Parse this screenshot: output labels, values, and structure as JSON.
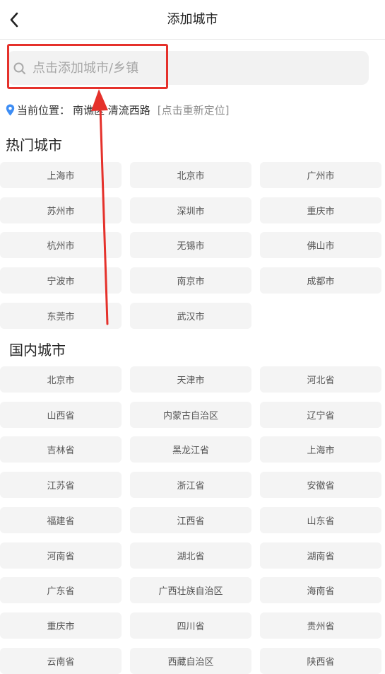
{
  "header": {
    "title": "添加城市",
    "back_icon": "chevron-left-icon"
  },
  "search": {
    "placeholder": "点击添加城市/乡镇",
    "icon": "search-icon"
  },
  "location": {
    "icon": "map-pin-icon",
    "label": "当前位置：",
    "value": "南谯区 清流西路",
    "relocate_label": "[点击重新定位]"
  },
  "hot": {
    "title": "热门城市",
    "cities": [
      "上海市",
      "北京市",
      "广州市",
      "苏州市",
      "深圳市",
      "重庆市",
      "杭州市",
      "无锡市",
      "佛山市",
      "宁波市",
      "南京市",
      "成都市",
      "东莞市",
      "武汉市"
    ]
  },
  "domestic": {
    "title": "国内城市",
    "cities": [
      "北京市",
      "天津市",
      "河北省",
      "山西省",
      "内蒙古自治区",
      "辽宁省",
      "吉林省",
      "黑龙江省",
      "上海市",
      "江苏省",
      "浙江省",
      "安徽省",
      "福建省",
      "江西省",
      "山东省",
      "河南省",
      "湖北省",
      "湖南省",
      "广东省",
      "广西壮族自治区",
      "海南省",
      "重庆市",
      "四川省",
      "贵州省",
      "云南省",
      "西藏自治区",
      "陕西省"
    ]
  },
  "colors": {
    "annotation": "#e5312b",
    "chip_bg": "#f4f4f4",
    "location_icon": "#3d8df5"
  }
}
